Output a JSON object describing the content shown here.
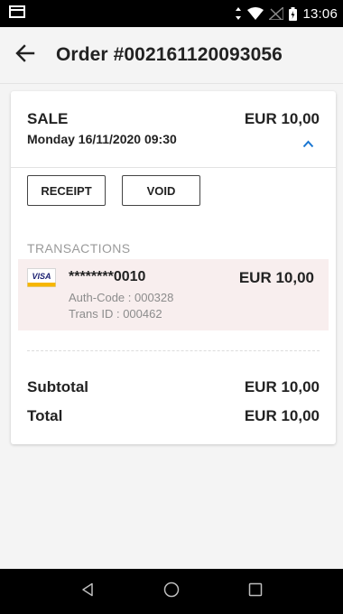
{
  "status_bar": {
    "time": "13:06",
    "icons": [
      "notification-icon",
      "data-arrows-icon",
      "wifi-icon",
      "no-signal-icon",
      "battery-icon"
    ]
  },
  "app_bar": {
    "back_icon": "arrow-back-icon",
    "title": "Order #002161120093056"
  },
  "order": {
    "type": "SALE",
    "date": "Monday 16/11/2020 09:30",
    "amount": "EUR 10,00",
    "collapse_icon": "chevron-up-icon",
    "receipt_label": "RECEIPT",
    "void_label": "VOID",
    "transactions_label": "TRANSACTIONS",
    "transaction": {
      "card_brand": "VISA",
      "card_number": "********0010",
      "auth_code": "Auth-Code : 000328",
      "trans_id": "Trans ID : 000462",
      "amount": "EUR 10,00"
    },
    "subtotal_label": "Subtotal",
    "subtotal_value": "EUR 10,00",
    "total_label": "Total",
    "total_value": "EUR 10,00"
  },
  "nav_bar": {
    "icons": [
      "back-triangle-icon",
      "home-circle-icon",
      "recents-square-icon"
    ]
  },
  "colors": {
    "accent": "#1976d2",
    "transaction_bg": "#f8eeee",
    "visa_blue": "#1a1f71",
    "visa_gold": "#f7b600"
  }
}
